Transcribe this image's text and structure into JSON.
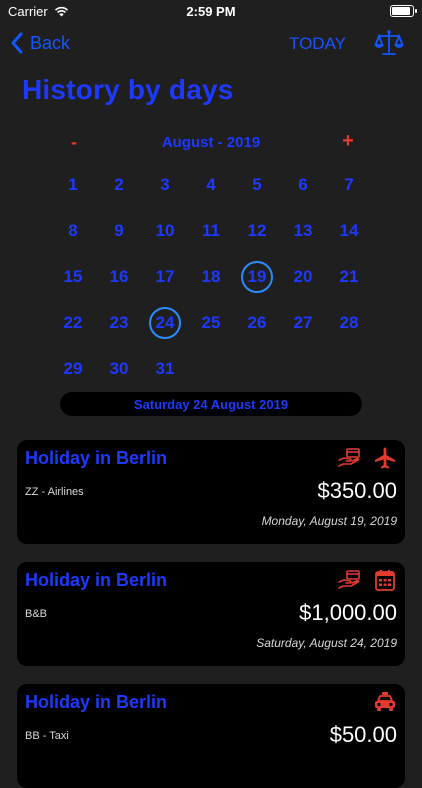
{
  "status": {
    "carrier": "Carrier",
    "time": "2:59 PM",
    "battery_level": 0.92
  },
  "nav": {
    "back_label": "Back",
    "today_label": "TODAY"
  },
  "page": {
    "title": "History by days"
  },
  "calendar": {
    "prev": "-",
    "next": "+",
    "month_label": "August - 2019",
    "days": [
      "1",
      "2",
      "3",
      "4",
      "5",
      "6",
      "7",
      "8",
      "9",
      "10",
      "11",
      "12",
      "13",
      "14",
      "15",
      "16",
      "17",
      "18",
      "19",
      "20",
      "21",
      "22",
      "23",
      "24",
      "25",
      "26",
      "27",
      "28",
      "29",
      "30",
      "31"
    ],
    "circled_days": [
      "19",
      "24"
    ]
  },
  "selected_date": "Saturday  24 August 2019",
  "expenses": [
    {
      "title": "Holiday in Berlin",
      "subtitle": "ZZ - Airlines",
      "amount": "$350.00",
      "date": "Monday, August 19, 2019",
      "icons": [
        "payment-icon",
        "airplane-icon"
      ]
    },
    {
      "title": "Holiday in Berlin",
      "subtitle": "B&B",
      "amount": "$1,000.00",
      "date": "Saturday, August 24, 2019",
      "icons": [
        "payment-icon",
        "calendar-icon"
      ]
    },
    {
      "title": "Holiday in Berlin",
      "subtitle": "BB - Taxi",
      "amount": "$50.00",
      "date": "",
      "icons": [
        "taxi-icon"
      ]
    }
  ],
  "colors": {
    "background": "#1f1f1f",
    "accent_blue": "#1e39ff",
    "link_blue": "#1456ff",
    "accent_red": "#e23b2e",
    "circle": "#2a8dff",
    "card": "#000000"
  }
}
